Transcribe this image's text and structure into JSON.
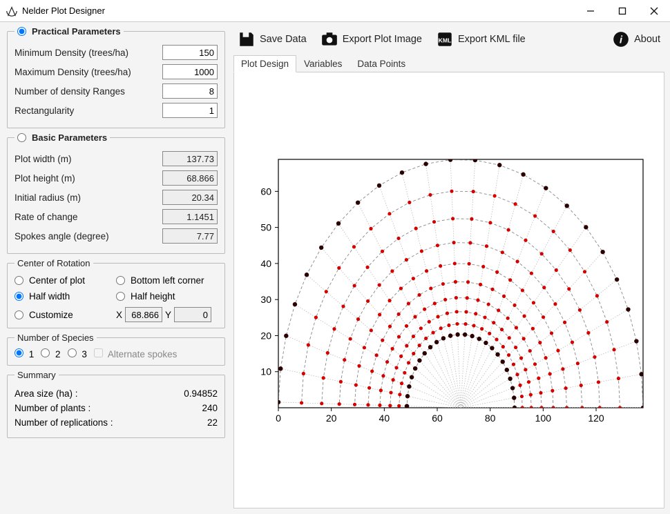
{
  "window": {
    "title": "Nelder Plot Designer"
  },
  "sections": {
    "practical": {
      "legend": "Practical Parameters",
      "min_density_label": "Minimum Density (trees/ha)",
      "min_density_value": "150",
      "max_density_label": "Maximum Density (trees/ha)",
      "max_density_value": "1000",
      "num_ranges_label": "Number of density Ranges",
      "num_ranges_value": "8",
      "rectangularity_label": "Rectangularity",
      "rectangularity_value": "1"
    },
    "basic": {
      "legend": "Basic Parameters",
      "plot_width_label": "Plot width (m)",
      "plot_width_value": "137.73",
      "plot_height_label": "Plot height (m)",
      "plot_height_value": "68.866",
      "initial_radius_label": "Initial radius (m)",
      "initial_radius_value": "20.34",
      "rate_label": "Rate of change",
      "rate_value": "1.1451",
      "spokes_angle_label": "Spokes angle (degree)",
      "spokes_angle_value": "7.77"
    },
    "center": {
      "legend": "Center of Rotation",
      "opt_center": "Center of plot",
      "opt_bottomleft": "Bottom left corner",
      "opt_halfwidth": "Half width",
      "opt_halfheight": "Half height",
      "opt_customize": "Customize",
      "x_label": "X",
      "x_value": "68.866",
      "y_label": "Y",
      "y_value": "0"
    },
    "species": {
      "legend": "Number of Species",
      "opt1": "1",
      "opt2": "2",
      "opt3": "3",
      "alt_label": "Alternate spokes"
    },
    "summary": {
      "legend": "Summary",
      "area_label": "Area size (ha) :",
      "area_value": "0.94852",
      "plants_label": "Number of plants :",
      "plants_value": "240",
      "reps_label": "Number of replications :",
      "reps_value": "22"
    }
  },
  "toolbar": {
    "save": "Save Data",
    "export_image": "Export Plot Image",
    "export_kml": "Export KML file",
    "about": "About"
  },
  "tabs": {
    "design": "Plot Design",
    "variables": "Variables",
    "datapoints": "Data Points"
  },
  "chart_data": {
    "type": "scatter",
    "title": "",
    "xlabel": "",
    "ylabel": "",
    "xlim": [
      0,
      137.73
    ],
    "ylim": [
      0,
      68.866
    ],
    "x_ticks": [
      0,
      20,
      40,
      60,
      80,
      100,
      120
    ],
    "y_ticks": [
      10,
      20,
      30,
      40,
      50,
      60
    ],
    "center": [
      68.866,
      0
    ],
    "spokes_angle_deg": 7.77,
    "num_spokes": 24,
    "rate_of_change": 1.1451,
    "initial_radius": 20.34,
    "radii": [
      20.34,
      23.29,
      26.67,
      30.54,
      34.97,
      40.05,
      45.86,
      52.51,
      60.13,
      68.87
    ],
    "ring_colors": [
      "#2b0000",
      "#d40000",
      "#d40000",
      "#d40000",
      "#d40000",
      "#d40000",
      "#d40000",
      "#d40000",
      "#d40000",
      "#2b0000"
    ],
    "annotations": []
  }
}
